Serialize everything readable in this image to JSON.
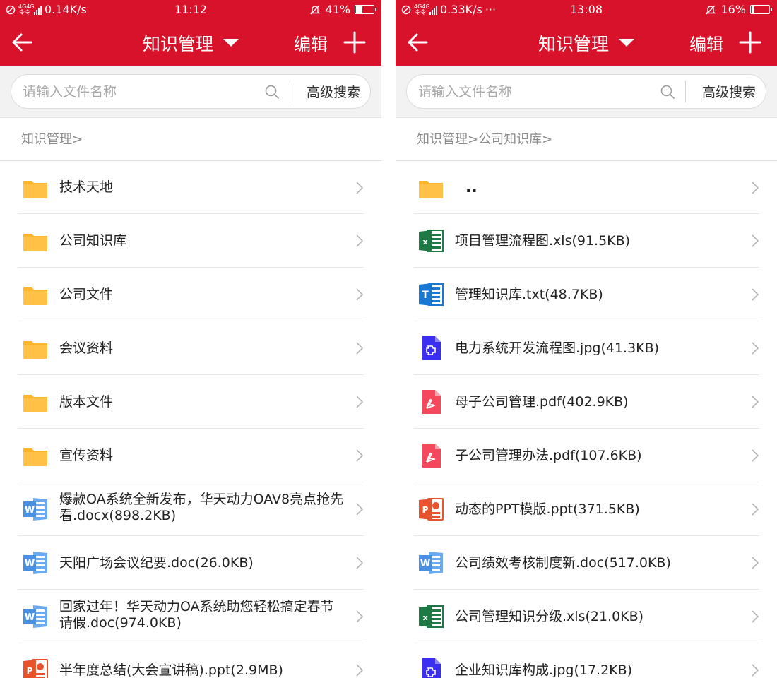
{
  "left": {
    "status": {
      "net_top": "4G4G",
      "net_bottom": "令令",
      "speed": "0.14K/s",
      "extra": "",
      "time": "11:12",
      "battery": "41%",
      "battery_level": 0.41
    },
    "nav": {
      "title": "知识管理",
      "edit_label": "编辑"
    },
    "search": {
      "placeholder": "请输入文件名称",
      "advanced_label": "高级搜索"
    },
    "breadcrumb": "知识管理>",
    "items": [
      {
        "type": "folder",
        "label": "技术天地"
      },
      {
        "type": "folder",
        "label": "公司知识库"
      },
      {
        "type": "folder",
        "label": "公司文件"
      },
      {
        "type": "folder",
        "label": "会议资料"
      },
      {
        "type": "folder",
        "label": "版本文件"
      },
      {
        "type": "folder",
        "label": "宣传资料"
      },
      {
        "type": "word",
        "label": "爆款OA系统全新发布，华天动力OAV8亮点抢先看.docx(898.2KB)"
      },
      {
        "type": "word",
        "label": "天阳广场会议纪要.doc(26.0KB)"
      },
      {
        "type": "word",
        "label": "回家过年！华天动力OA系统助您轻松搞定春节请假.doc(974.0KB)"
      },
      {
        "type": "ppt",
        "label": "半年度总结(大会宣讲稿).ppt(2.9MB)"
      }
    ]
  },
  "right": {
    "status": {
      "net_top": "4G4G",
      "net_bottom": "令令",
      "speed": "0.33K/s",
      "extra": "···",
      "time": "13:08",
      "battery": "16%",
      "battery_level": 0.16
    },
    "nav": {
      "title": "知识管理",
      "edit_label": "编辑"
    },
    "search": {
      "placeholder": "请输入文件名称",
      "advanced_label": "高级搜索"
    },
    "breadcrumb": "知识管理>公司知识库>",
    "items": [
      {
        "type": "folder",
        "label": ".."
      },
      {
        "type": "excel",
        "label": "项目管理流程图.xls(91.5KB)"
      },
      {
        "type": "txt",
        "label": "管理知识库.txt(48.7KB)"
      },
      {
        "type": "image",
        "label": "电力系统开发流程图.jpg(41.3KB)"
      },
      {
        "type": "pdf",
        "label": "母子公司管理.pdf(402.9KB)"
      },
      {
        "type": "pdf",
        "label": "子公司管理办法.pdf(107.6KB)"
      },
      {
        "type": "ppt",
        "label": "动态的PPT模版.ppt(371.5KB)"
      },
      {
        "type": "word",
        "label": "公司绩效考核制度新.doc(517.0KB)"
      },
      {
        "type": "excel",
        "label": "公司管理知识分级.xls(21.0KB)"
      },
      {
        "type": "image",
        "label": "企业知识库构成.jpg(17.2KB)"
      }
    ]
  },
  "colors": {
    "header": "#d8122a",
    "folder": "#fdb52c",
    "word": "#4a90e2",
    "excel": "#1d7a45",
    "ppt": "#e8522d",
    "pdf": "#f5485d",
    "txt": "#1878d3",
    "image": "#3b2ff2"
  },
  "icons": {
    "back": "arrow-left-icon",
    "add": "plus-icon",
    "caret": "caret-down-icon",
    "search": "search-icon",
    "chevron": "chevron-right-icon"
  }
}
